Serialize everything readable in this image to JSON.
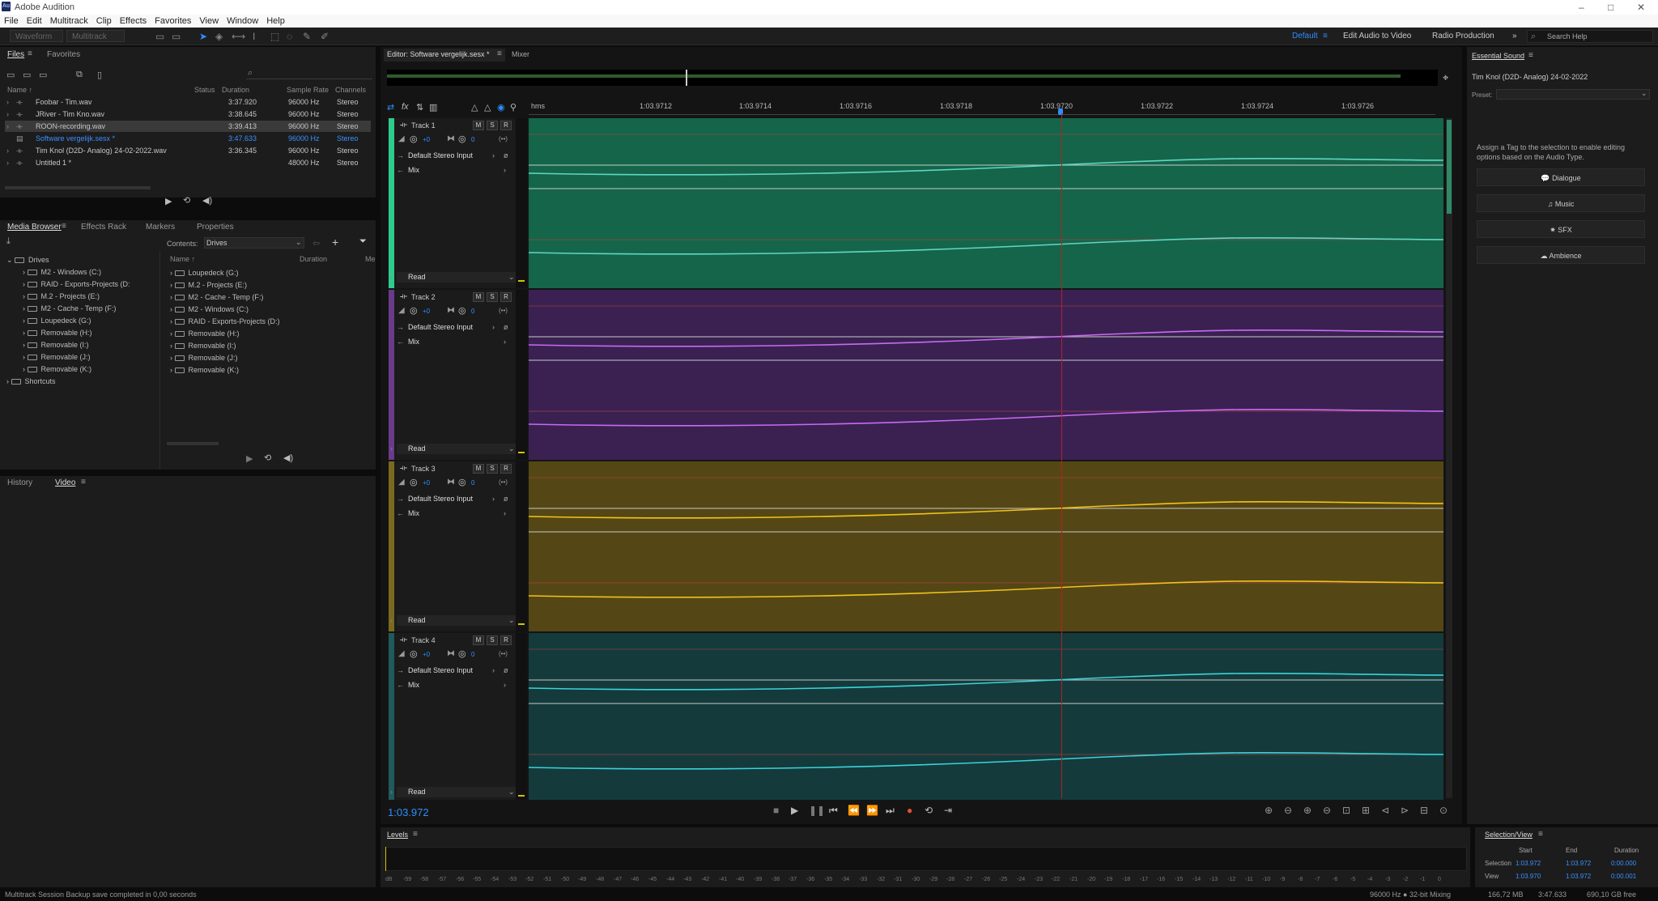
{
  "window": {
    "app_title": "Adobe Audition",
    "logo": "Au",
    "minimize": "–",
    "maximize": "□",
    "close": "✕"
  },
  "menu": [
    "File",
    "Edit",
    "Multitrack",
    "Clip",
    "Effects",
    "Favorites",
    "View",
    "Window",
    "Help"
  ],
  "toolbar": {
    "waveform": "Waveform",
    "multitrack": "Multitrack",
    "workspaces": [
      "Default",
      "Edit Audio to Video",
      "Radio Production"
    ],
    "more": "»",
    "search_placeholder": "Search Help"
  },
  "files_panel": {
    "tabs": [
      "Files",
      "Favorites"
    ],
    "columns": [
      "Name ↑",
      "Status",
      "Duration",
      "Sample Rate",
      "Channels"
    ],
    "rows": [
      {
        "name": "Foobar - Tim.wav",
        "duration": "3:37.920",
        "rate": "96000 Hz",
        "channels": "Stereo"
      },
      {
        "name": "JRiver - Tim Kno.wav",
        "duration": "3:38.645",
        "rate": "96000 Hz",
        "channels": "Stereo"
      },
      {
        "name": "ROON-recording.wav",
        "duration": "3:39.413",
        "rate": "96000 Hz",
        "channels": "Stereo"
      },
      {
        "name": "Software vergelijk.sesx *",
        "duration": "3:47.633",
        "rate": "96000 Hz",
        "channels": "Stereo"
      },
      {
        "name": "Tim Knol (D2D- Analog) 24-02-2022.wav",
        "duration": "3:36.345",
        "rate": "96000 Hz",
        "channels": "Stereo"
      },
      {
        "name": "Untitled 1 *",
        "duration": "",
        "rate": "48000 Hz",
        "channels": "Stereo"
      }
    ]
  },
  "media_browser": {
    "tabs": [
      "Media Browser",
      "Effects Rack",
      "Markers",
      "Properties"
    ],
    "contents_label": "Contents:",
    "contents_value": "Drives",
    "tree": [
      "Drives",
      "M2 - Windows (C:)",
      "RAID - Exports-Projects (D:",
      "M.2 - Projects (E:)",
      "M2 - Cache - Temp (F:)",
      "Loupedeck (G:)",
      "Removable (H:)",
      "Removable (I:)",
      "Removable (J:)",
      "Removable (K:)",
      "Shortcuts"
    ],
    "columns": [
      "Name ↑",
      "Duration",
      "Me"
    ],
    "list": [
      "Loupedeck (G:)",
      "M.2 - Projects (E:)",
      "M2 - Cache - Temp (F:)",
      "M2 - Windows (C:)",
      "RAID - Exports-Projects (D:)",
      "Removable (H:)",
      "Removable (I:)",
      "Removable (J:)",
      "Removable (K:)"
    ]
  },
  "history_panel": {
    "tabs": [
      "History",
      "Video"
    ]
  },
  "editor": {
    "tab_label": "Editor: Software vergelijk.sesx *",
    "mixer_tab": "Mixer",
    "ruler_unit": "hms",
    "ticks": [
      "1:03.9712",
      "1:03.9714",
      "1:03.9716",
      "1:03.9718",
      "1:03.9720",
      "1:03.9722",
      "1:03.9724",
      "1:03.9726"
    ],
    "tracks": [
      {
        "name": "Track 1",
        "volume": "+0",
        "pan": "0",
        "input": "Default Stereo Input",
        "output": "Mix",
        "automation": "Read",
        "color": "#15654a",
        "wave": "#5fd7c4",
        "accent": "#2ecc8a"
      },
      {
        "name": "Track 2",
        "volume": "+0",
        "pan": "0",
        "input": "Default Stereo Input",
        "output": "Mix",
        "automation": "Read",
        "color": "#3a2152",
        "wave": "#c86bf0",
        "accent": "#6a3b8a"
      },
      {
        "name": "Track 3",
        "volume": "+0",
        "pan": "0",
        "input": "Default Stereo Input",
        "output": "Mix",
        "automation": "Read",
        "color": "#544715",
        "wave": "#f2c31a",
        "accent": "#7a6a1f"
      },
      {
        "name": "Track 4",
        "volume": "+0",
        "pan": "0",
        "input": "Default Stereo Input",
        "output": "Mix",
        "automation": "Read",
        "color": "#153a3c",
        "wave": "#3ad3d8",
        "accent": "#215a5c"
      }
    ],
    "msr": [
      "M",
      "S",
      "R"
    ],
    "time_display": "1:03.972"
  },
  "essential_sound": {
    "title": "Essential Sound",
    "clip_name": "Tim Knol (D2D- Analog) 24-02-2022",
    "preset_label": "Preset:",
    "hint": "Assign a Tag to the selection to enable editing options based on the Audio Type.",
    "types": [
      "Dialogue",
      "Music",
      "SFX",
      "Ambience"
    ]
  },
  "levels": {
    "title": "Levels",
    "scale": [
      "dB",
      "-59",
      "-58",
      "-57",
      "-56",
      "-55",
      "-54",
      "-53",
      "-52",
      "-51",
      "-50",
      "-49",
      "-48",
      "-47",
      "-46",
      "-45",
      "-44",
      "-43",
      "-42",
      "-41",
      "-40",
      "-39",
      "-38",
      "-37",
      "-36",
      "-35",
      "-34",
      "-33",
      "-32",
      "-31",
      "-30",
      "-29",
      "-28",
      "-27",
      "-26",
      "-25",
      "-24",
      "-23",
      "-22",
      "-21",
      "-20",
      "-19",
      "-18",
      "-17",
      "-16",
      "-15",
      "-14",
      "-13",
      "-12",
      "-11",
      "-10",
      "-9",
      "-8",
      "-7",
      "-6",
      "-5",
      "-4",
      "-3",
      "-2",
      "-1",
      "0"
    ]
  },
  "selection_view": {
    "title": "Selection/View",
    "headers": [
      "Start",
      "End",
      "Duration"
    ],
    "selection": {
      "label": "Selection",
      "start": "1:03.972",
      "end": "1:03.972",
      "duration": "0:00.000"
    },
    "view": {
      "label": "View",
      "start": "1:03.970",
      "end": "1:03.972",
      "duration": "0:00.001"
    }
  },
  "status": {
    "left": "Multitrack Session Backup save completed in 0,00 seconds",
    "format": "96000 Hz ● 32-bit Mixing",
    "memory": "166,72 MB",
    "duration": "3:47.633",
    "free": "690,10 GB free"
  }
}
